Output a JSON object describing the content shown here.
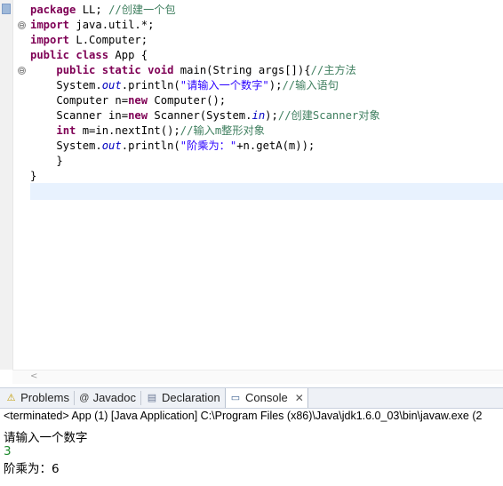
{
  "editor": {
    "lines": [
      [
        {
          "t": "package",
          "c": "kw"
        },
        {
          "t": " LL; "
        },
        {
          "t": "//创建一个包",
          "c": "cm"
        }
      ],
      [
        {
          "t": "import",
          "c": "kw"
        },
        {
          "t": " java.util.*;"
        }
      ],
      [
        {
          "t": "import",
          "c": "kw"
        },
        {
          "t": " L.Computer;"
        }
      ],
      [
        {
          "t": "public",
          "c": "kw"
        },
        {
          "t": " "
        },
        {
          "t": "class",
          "c": "kw"
        },
        {
          "t": " App {"
        }
      ],
      [
        {
          "t": "    "
        },
        {
          "t": "public",
          "c": "kw"
        },
        {
          "t": " "
        },
        {
          "t": "static",
          "c": "kw"
        },
        {
          "t": " "
        },
        {
          "t": "void",
          "c": "kw"
        },
        {
          "t": " main(String args[]){"
        },
        {
          "t": "//主方法",
          "c": "cm"
        }
      ],
      [
        {
          "t": "    System."
        },
        {
          "t": "out",
          "c": "fld"
        },
        {
          "t": ".println("
        },
        {
          "t": "\"请输入一个数字\"",
          "c": "str"
        },
        {
          "t": ");"
        },
        {
          "t": "//输入语句",
          "c": "cm"
        }
      ],
      [
        {
          "t": "    Computer n="
        },
        {
          "t": "new",
          "c": "kw"
        },
        {
          "t": " Computer();"
        }
      ],
      [
        {
          "t": "    Scanner in="
        },
        {
          "t": "new",
          "c": "kw"
        },
        {
          "t": " Scanner(System."
        },
        {
          "t": "in",
          "c": "fld"
        },
        {
          "t": ");"
        },
        {
          "t": "//创建Scanner对象",
          "c": "cm"
        }
      ],
      [
        {
          "t": "    "
        },
        {
          "t": "int",
          "c": "kw"
        },
        {
          "t": " m=in.nextInt();"
        },
        {
          "t": "//输入m整形对象",
          "c": "cm"
        }
      ],
      [
        {
          "t": "    System."
        },
        {
          "t": "out",
          "c": "fld"
        },
        {
          "t": ".println("
        },
        {
          "t": "\"阶乘为：\"",
          "c": "str"
        },
        {
          "t": "+n.getA(m));"
        }
      ],
      [
        {
          "t": "    }"
        }
      ],
      [
        {
          "t": "}"
        }
      ]
    ],
    "fold_markers": [
      "⊖",
      "⊖"
    ],
    "scroll_left_arrow": "<"
  },
  "tabs": [
    {
      "label": "Problems",
      "icon": "problems-icon",
      "glyph": "⚠"
    },
    {
      "label": "Javadoc",
      "icon": "javadoc-icon",
      "glyph": "@"
    },
    {
      "label": "Declaration",
      "icon": "declaration-icon",
      "glyph": "▤"
    },
    {
      "label": "Console",
      "icon": "console-icon",
      "glyph": "▭",
      "active": true,
      "close": "✕"
    }
  ],
  "console": {
    "status": "<terminated> App (1) [Java Application] C:\\Program Files (x86)\\Java\\jdk1.6.0_03\\bin\\javaw.exe (2",
    "output": [
      {
        "text": "请输入一个数字",
        "type": "stdout"
      },
      {
        "text": "3",
        "type": "input"
      },
      {
        "text": "阶乘为：6",
        "type": "stdout"
      }
    ]
  },
  "colors": {
    "keyword": "#7f0055",
    "comment": "#3f7f5f",
    "string": "#2a00ff",
    "static_field": "#0000c0",
    "console_input": "#1e8a2e"
  }
}
